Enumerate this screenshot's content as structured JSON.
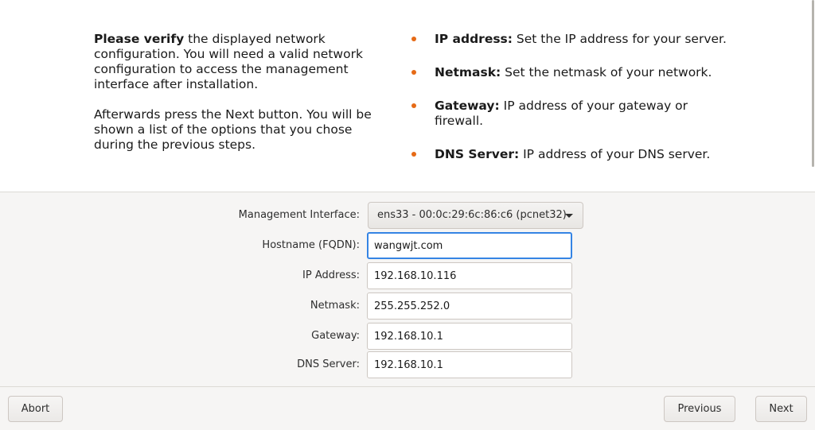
{
  "intro": {
    "p1_bold": "Please verify",
    "p1_rest": " the displayed network configuration. You will need a valid network configuration to access the management interface after installation.",
    "p2": "Afterwards press the Next button. You will be shown a list of the options that you chose during the previous steps."
  },
  "bullets": [
    {
      "term": "IP address:",
      "desc": " Set the IP address for your server."
    },
    {
      "term": "Netmask:",
      "desc": " Set the netmask of your network."
    },
    {
      "term": "Gateway:",
      "desc": " IP address of your gateway or firewall."
    },
    {
      "term": "DNS Server:",
      "desc": " IP address of your DNS server."
    }
  ],
  "form": {
    "management_interface": {
      "label": "Management Interface:",
      "value": "ens33 - 00:0c:29:6c:86:c6 (pcnet32)"
    },
    "hostname": {
      "label": "Hostname (FQDN):",
      "value": "wangwjt.com"
    },
    "ip_address": {
      "label": "IP Address:",
      "value": "192.168.10.116"
    },
    "netmask": {
      "label": "Netmask:",
      "value": "255.255.252.0"
    },
    "gateway": {
      "label": "Gateway:",
      "value": "192.168.10.1"
    },
    "dns_server": {
      "label": "DNS Server:",
      "value": "192.168.10.1"
    }
  },
  "buttons": {
    "abort": "Abort",
    "previous": "Previous",
    "next": "Next"
  },
  "colors": {
    "bullet": "#e66a16",
    "focus": "#3584e4"
  }
}
